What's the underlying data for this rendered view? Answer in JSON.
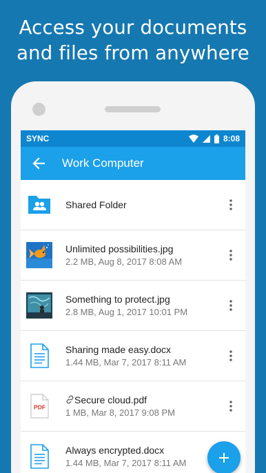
{
  "headline": {
    "line1": "Access your documents",
    "line2": "and files from anywhere"
  },
  "status_bar": {
    "carrier_label": "SYNC",
    "time": "8:08"
  },
  "app_bar": {
    "title": "Work Computer"
  },
  "files": [
    {
      "name": "Shared Folder",
      "meta": "",
      "icon": "shared-folder-icon"
    },
    {
      "name": "Unlimited possibilities.jpg",
      "meta": "2.2 MB, Aug 8, 2017 8:08 AM",
      "icon": "goldfish-thumbnail"
    },
    {
      "name": "Something to protect.jpg",
      "meta": "2.8 MB, Aug 1, 2017 10:01 PM",
      "icon": "aquarium-thumbnail"
    },
    {
      "name": "Sharing made easy.docx",
      "meta": "1.44 MB, Mar 7, 2017 8:11 AM",
      "icon": "document-icon"
    },
    {
      "name": "Secure cloud.pdf",
      "meta": "1 MB, Mar 8, 2017 9:08 PM",
      "icon": "pdf-icon",
      "pdf_label": "PDF"
    },
    {
      "name": "Always encrypted.docx",
      "meta": "1.44 MB, Mar 7, 2017 8:11 AM",
      "icon": "document-icon"
    }
  ],
  "colors": {
    "background": "#1678b0",
    "status_bar": "#0d86cf",
    "app_bar": "#1ba0ea",
    "fab": "#1ba0ea"
  }
}
